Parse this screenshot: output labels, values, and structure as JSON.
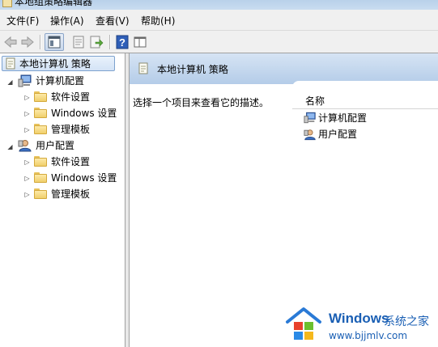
{
  "window": {
    "title": "本地组策略编辑器"
  },
  "menu": [
    {
      "label": "文件(F)"
    },
    {
      "label": "操作(A)"
    },
    {
      "label": "查看(V)"
    },
    {
      "label": "帮助(H)"
    }
  ],
  "toolbar": {
    "icons": [
      "back-arrow-icon",
      "forward-arrow-icon",
      "show-hide-tree-icon",
      "properties-icon",
      "export-list-icon",
      "help-icon",
      "extended-view-icon"
    ]
  },
  "tree": {
    "root": {
      "label": "本地计算机 策略"
    },
    "computer": {
      "label": "计算机配置",
      "children": [
        {
          "label": "软件设置"
        },
        {
          "label": "Windows 设置"
        },
        {
          "label": "管理模板"
        }
      ]
    },
    "user": {
      "label": "用户配置",
      "children": [
        {
          "label": "软件设置"
        },
        {
          "label": "Windows 设置"
        },
        {
          "label": "管理模板"
        }
      ]
    }
  },
  "details": {
    "title": "本地计算机 策略",
    "description": "选择一个项目来查看它的描述。",
    "column_name": "名称",
    "items": [
      {
        "label": "计算机配置"
      },
      {
        "label": "用户配置"
      }
    ]
  },
  "watermark": {
    "brand": "Windows",
    "site_cn": "系统之家",
    "url": "www.bjjmlv.com"
  }
}
